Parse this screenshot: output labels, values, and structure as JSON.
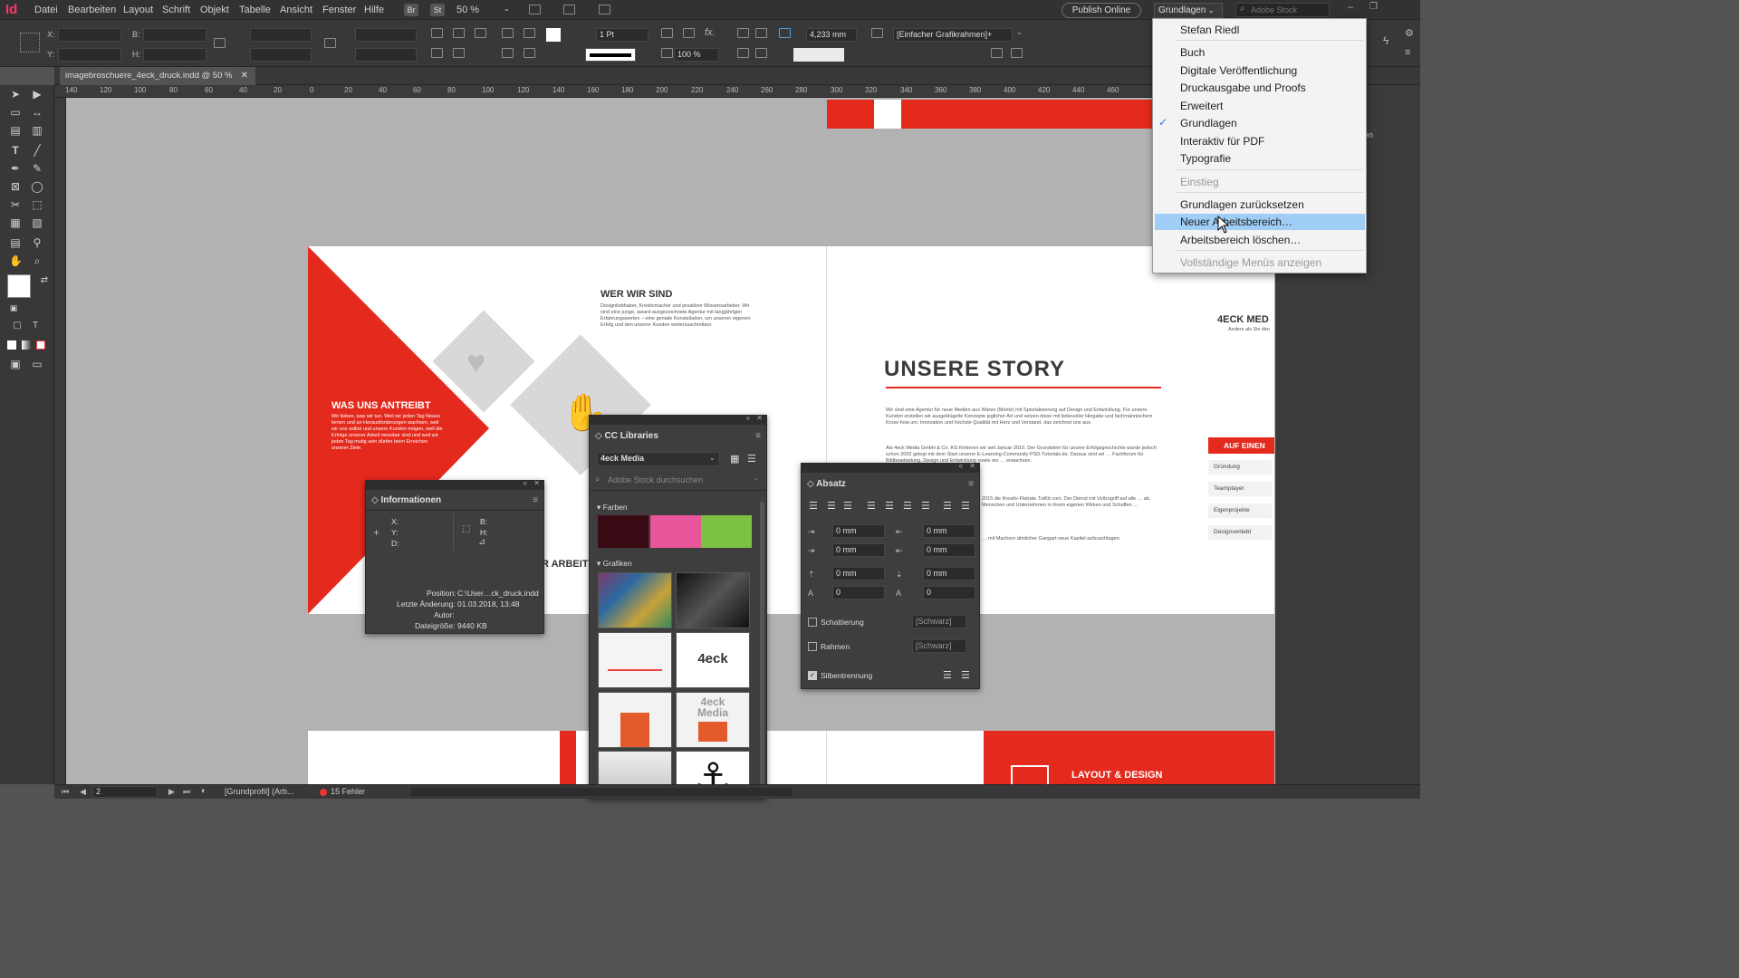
{
  "app": {
    "logo": "Id",
    "menus": [
      "Datei",
      "Bearbeiten",
      "Layout",
      "Schrift",
      "Objekt",
      "Tabelle",
      "Ansicht",
      "Fenster",
      "Hilfe"
    ],
    "bridge": "Br",
    "stock": "St",
    "zoom": "50 %",
    "publish": "Publish Online",
    "workspace": "Grundlagen",
    "stock_search_placeholder": "Adobe Stock"
  },
  "control": {
    "x_label": "X:",
    "y_label": "Y:",
    "w_label": "B:",
    "h_label": "H:",
    "stroke_weight": "1 Pt",
    "scale": "100 %",
    "offset": "4,233 mm",
    "object_style": "[Einfacher Grafikrahmen]+"
  },
  "document": {
    "tab_title": "imagebroschuere_4eck_druck.indd @ 50 %"
  },
  "ruler": {
    "ticks": [
      "140",
      "120",
      "100",
      "80",
      "60",
      "40",
      "20",
      "0",
      "20",
      "40",
      "60",
      "80",
      "100",
      "120",
      "140",
      "160",
      "180",
      "200",
      "220",
      "240",
      "260",
      "280",
      "300",
      "320",
      "340",
      "360",
      "380",
      "400",
      "420",
      "440",
      "460"
    ]
  },
  "canvas": {
    "who_title": "WER WIR SIND",
    "who_text": "Designliebhaber, Kreativmacher und proaktive Wissensarbeiter. Wir sind eine junge, award-ausgezeichnete Agentur mit langjährigen Erfahrungswerten – eine geniale Konstellation, um unseren eigenen Erfolg und den unserer Kunden weiterzuschreiben.",
    "drive_title": "WAS UNS ANTREIBT",
    "drive_text": "Wir lieben, was wir tun. Weil wir jeden Tag Neues lernen und an Herausforderungen wachsen, weil wir uns selbst und unsere Kunden mögen, weil die Erfolge unserer Arbeit messbar sind und weil wir jeden Tag mutig sein dürfen beim Erreichen unserer Ziele.",
    "work_title": "R ARBEIT",
    "story_title": "UNSERE STORY",
    "story_p1": "Wir sind eine Agentur für neue Medien aus Waren (Müritz) mit Spezialisierung auf Design und Entwicklung. Für unsere Kunden erstellen wir ausgeklügelte Konzepte jeglicher Art und setzen diese mit liebevoller Hingabe und fachmännischem Know-how um. Innovation und höchste Qualität mit Herz und Verstand, das zeichnet uns aus.",
    "story_p2": "Als 4eck Media GmbH & Co. KG firmieren wir seit Januar 2010. Der Grundstein für unsere Erfolgsgeschichte wurde jedoch schon 2002 gelegt mit dem Start unserer E-Learning-Community PSD-Tutorials.de. Daraus sind wir … Fachforum für Bildbearbeitung, Design und Entwicklung sowie ein … erwachsen.",
    "story_p3": "2015 die Kreativ-Flatrate TutKit.com. Der Dienst mit Vollzugriff auf alle … ab, Menschen und Unternehmen in ihrem eigenen Wirken und Schaffen …",
    "story_p4": "… mit Machern ähnlicher Gangart neue Kapitel aufzuschlagen.",
    "brand": "4ECK MED",
    "brand_sub": "Anders als Sie den",
    "aufeinen": "AUF EINEN",
    "side_items": [
      "Gründung",
      "Teamplayer",
      "Eigenprojekte",
      "Designverliebt"
    ],
    "layout_design": "LAYOUT & DESIGN"
  },
  "info_panel": {
    "title": "Informationen",
    "x": "X:",
    "y": "Y:",
    "d": "D:",
    "b": "B:",
    "h": "H:",
    "position_label": "Position:",
    "position": "C:\\User…ck_druck.indd",
    "changed_label": "Letzte Änderung:",
    "changed": "01.03.2018, 13:48",
    "author_label": "Autor:",
    "author": "",
    "size_label": "Dateigröße:",
    "size": "9440 KB"
  },
  "cc_panel": {
    "title": "CC Libraries",
    "library": "4eck Media",
    "search_placeholder": "Adobe Stock durchsuchen",
    "colors_label": "Farben",
    "graphics_label": "Grafiken",
    "swatches": [
      "#3a0a14",
      "#e8559a",
      "#7dc142"
    ],
    "logo_text": "4eck Media",
    "logo_small_1": "4eck",
    "logo_small_2": "Media"
  },
  "para_panel": {
    "title": "Absatz",
    "fields": [
      "0 mm",
      "0 mm",
      "0 mm",
      "0 mm",
      "0 mm",
      "0 mm",
      "0",
      "0"
    ],
    "shading": "Schattierung",
    "border": "Rahmen",
    "hyphen": "Silbentrennung",
    "black": "[Schwarz]"
  },
  "status": {
    "page": "2",
    "profile": "[Grundprofil] (Arb...",
    "errors": "15 Fehler"
  },
  "ws_menu": {
    "items": [
      {
        "label": "Stefan Riedl",
        "state": "normal"
      },
      {
        "label": "Buch",
        "state": "normal"
      },
      {
        "label": "Digitale Veröffentlichung",
        "state": "normal"
      },
      {
        "label": "Druckausgabe und Proofs",
        "state": "normal"
      },
      {
        "label": "Erweitert",
        "state": "normal"
      },
      {
        "label": "Grundlagen",
        "state": "checked"
      },
      {
        "label": "Interaktiv für PDF",
        "state": "normal"
      },
      {
        "label": "Typografie",
        "state": "normal"
      },
      {
        "label": "Einstieg",
        "state": "disabled"
      },
      {
        "label": "Grundlagen zurücksetzen",
        "state": "normal"
      },
      {
        "label": "Neuer Arbeitsbereich…",
        "state": "highlighted"
      },
      {
        "label": "Arbeitsbereich löschen…",
        "state": "normal"
      },
      {
        "label": "Vollständige Menüs anzeigen",
        "state": "disabled"
      }
    ]
  },
  "dock": {
    "partial_label": "en"
  },
  "colors": {
    "brand_red": "#e32a1d",
    "menu_highlight": "#9fcdf5",
    "app_pink": "#ff3366"
  }
}
